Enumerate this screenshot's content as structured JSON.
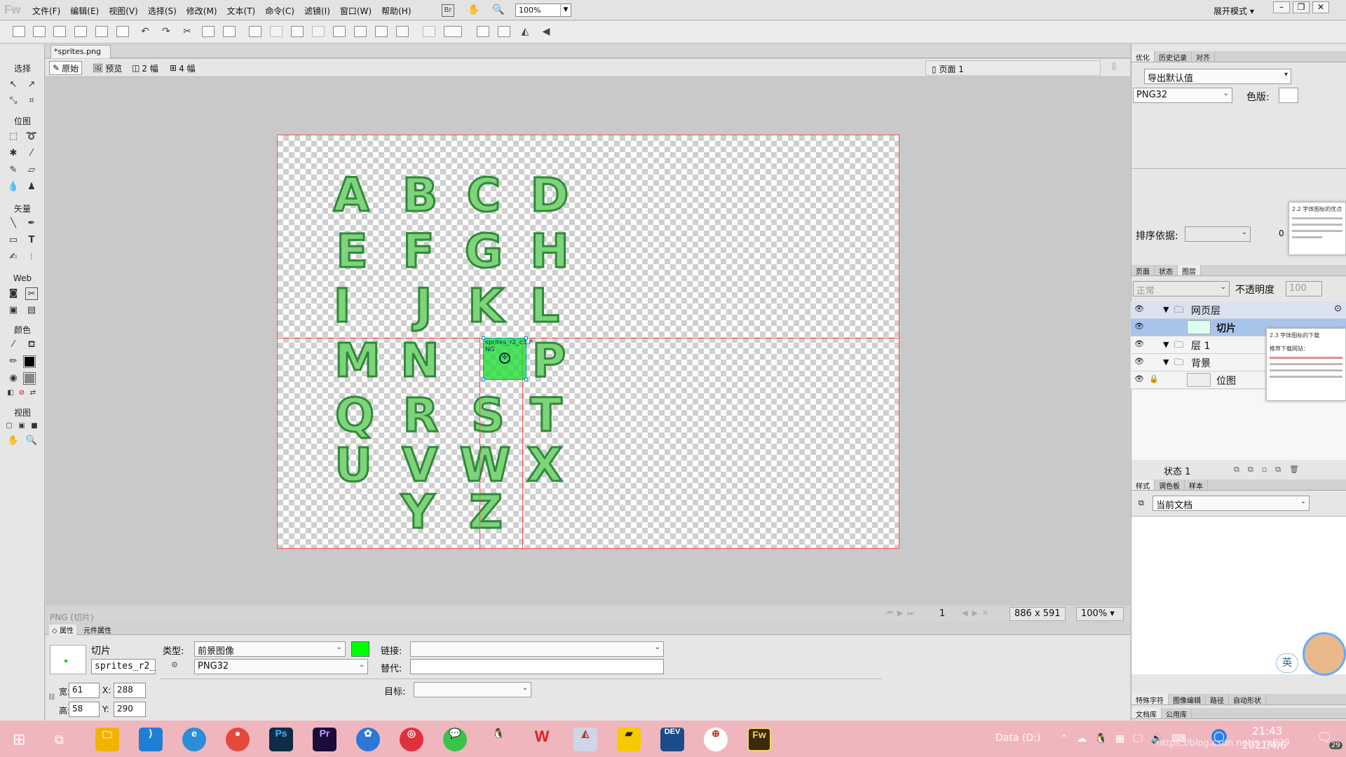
{
  "app": {
    "logo": "Fw"
  },
  "menu": [
    "文件(F)",
    "编辑(E)",
    "视图(V)",
    "选择(S)",
    "修改(M)",
    "文本(T)",
    "命令(C)",
    "滤镜(I)",
    "窗口(W)",
    "帮助(H)"
  ],
  "zoom_top": "100%",
  "expand_mode": "展开模式",
  "document": {
    "tab_name": "*sprites.png",
    "views": {
      "original": "原始",
      "preview": "预览",
      "two_up": "2 幅",
      "four_up": "4 幅"
    },
    "page_label": "页面 1"
  },
  "left_tools": {
    "select": "选择",
    "bitmap": "位图",
    "vector": "矢量",
    "web": "Web",
    "colors": "颜色",
    "view": "视图"
  },
  "canvas": {
    "letters": [
      "A",
      "B",
      "C",
      "D",
      "E",
      "F",
      "G",
      "H",
      "I",
      "J",
      "K",
      "L",
      "M",
      "N",
      "",
      "P",
      "Q",
      "R",
      "S",
      "T",
      "U",
      "V",
      "W",
      "X",
      "Y",
      "Z"
    ],
    "slice_label": "sprites_r2_c3.png",
    "slice_label_line1": "sprites_r2_c3.P",
    "slice_label_line2": "NG"
  },
  "status": {
    "file_info": "PNG (切片)",
    "frame": "1",
    "dimensions": "886 x 591",
    "zoom": "100%"
  },
  "properties": {
    "tab_props": "属性",
    "tab_symbol": "元件属性",
    "object_type": "切片",
    "slice_name": "sprites_r2_",
    "type_label": "类型:",
    "type_value": "前景图像",
    "format_value": "PNG32",
    "link_label": "链接:",
    "alt_label": "替代:",
    "target_label": "目标:",
    "width_label": "宽:",
    "width": "61",
    "height_label": "高:",
    "height": "58",
    "x_label": "X:",
    "x": "288",
    "y_label": "Y:",
    "y": "290",
    "slice_color": "#00ff00"
  },
  "right_panel": {
    "tabs_top": [
      "优化",
      "历史记录",
      "对齐"
    ],
    "export_default": "导出默认值",
    "format": "PNG32",
    "palette_label": "色版:",
    "sort_label": "排序依据:",
    "sort_count": "0",
    "tabs_layers": [
      "页面",
      "状态",
      "图层"
    ],
    "blend_mode": "正常",
    "opacity_label": "不透明度",
    "opacity_value": "100",
    "layers": [
      {
        "name": "网页层",
        "kind": "folder"
      },
      {
        "name": "切片",
        "kind": "item"
      },
      {
        "name": "层 1",
        "kind": "folder"
      },
      {
        "name": "背景",
        "kind": "folder"
      },
      {
        "name": "位图",
        "kind": "item"
      }
    ],
    "state_label": "状态 1",
    "tabs_styles": [
      "样式",
      "调色板",
      "样本"
    ],
    "current_doc": "当前文档",
    "tabs_bottom1": [
      "特殊字符",
      "图像编辑",
      "路径",
      "自动形状"
    ],
    "tabs_bottom2": [
      "文档库",
      "公用库"
    ]
  },
  "popups": {
    "p1_title": "2.2 字体图标的优点",
    "p2_title": "2.3 字体图标的下载",
    "p2_sub": "推荐下载网站："
  },
  "ime_label": "英",
  "taskbar": {
    "apps": [
      "Ps",
      "Pr",
      "DEV",
      "Fw"
    ],
    "drive": "Data (D:)",
    "time": "21:43",
    "date": "2021/4/6",
    "watermark": "https://blog.csdn.net/s_m029",
    "notif_count": "29"
  },
  "colors": {
    "accent": "#00ff00",
    "slice_line": "#ff4d4d",
    "taskbar": "#f0b6be"
  }
}
